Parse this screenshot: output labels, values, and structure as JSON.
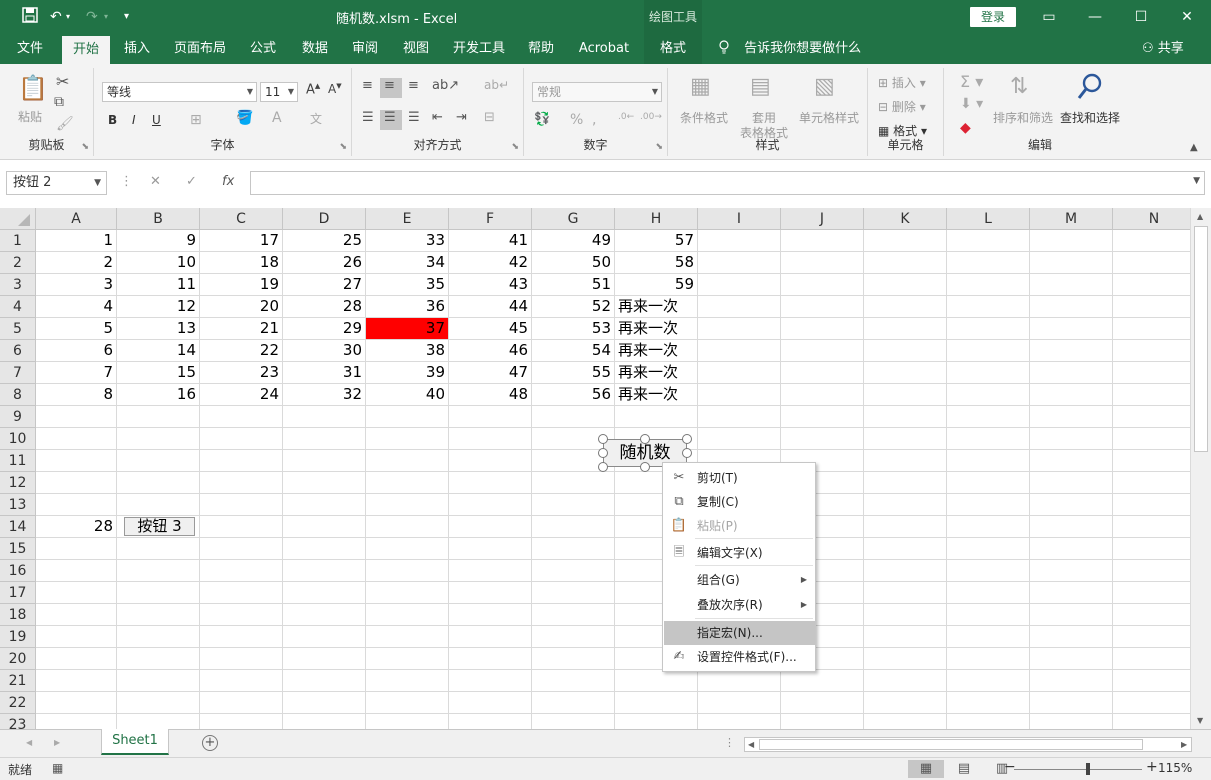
{
  "window": {
    "title": "随机数.xlsm  -  Excel",
    "drawing_tools": "绘图工具",
    "login": "登录",
    "tell_me": "告诉我你想要做什么",
    "share": "共享"
  },
  "tabs": [
    "文件",
    "开始",
    "插入",
    "页面布局",
    "公式",
    "数据",
    "审阅",
    "视图",
    "开发工具",
    "帮助",
    "Acrobat",
    "格式"
  ],
  "active_tab": "开始",
  "ribbon": {
    "clipboard": {
      "label": "剪贴板",
      "paste": "粘贴"
    },
    "font": {
      "label": "字体",
      "font_name": "等线",
      "font_size": "11",
      "bold": "B",
      "italic": "I",
      "underline": "U"
    },
    "align": {
      "label": "对齐方式"
    },
    "number": {
      "label": "数字",
      "format": "常规"
    },
    "styles": {
      "label": "样式",
      "conditional": "条件格式",
      "table_format_1": "套用",
      "table_format_2": "表格格式",
      "cell_styles": "单元格样式"
    },
    "cells": {
      "label": "单元格",
      "insert": "插入",
      "delete": "删除",
      "format": "格式"
    },
    "editing": {
      "label": "编辑",
      "sort_filter": "排序和筛选",
      "find_select_1": "查找和选择"
    }
  },
  "formula_bar": {
    "name_box": "按钮 2",
    "fx": "fx",
    "value": ""
  },
  "columns": [
    "A",
    "B",
    "C",
    "D",
    "E",
    "F",
    "G",
    "H",
    "I",
    "J",
    "K",
    "L",
    "M",
    "N"
  ],
  "rows": [
    "1",
    "2",
    "3",
    "4",
    "5",
    "6",
    "7",
    "8",
    "9",
    "10",
    "11",
    "12",
    "13",
    "14",
    "15",
    "16",
    "17",
    "18",
    "19",
    "20",
    "21",
    "22",
    "23"
  ],
  "cells": [
    [
      "1",
      "9",
      "17",
      "25",
      "33",
      "41",
      "49",
      "57"
    ],
    [
      "2",
      "10",
      "18",
      "26",
      "34",
      "42",
      "50",
      "58"
    ],
    [
      "3",
      "11",
      "19",
      "27",
      "35",
      "43",
      "51",
      "59"
    ],
    [
      "4",
      "12",
      "20",
      "28",
      "36",
      "44",
      "52",
      "再来一次"
    ],
    [
      "5",
      "13",
      "21",
      "29",
      "37",
      "45",
      "53",
      "再来一次"
    ],
    [
      "6",
      "14",
      "22",
      "30",
      "38",
      "46",
      "54",
      "再来一次"
    ],
    [
      "7",
      "15",
      "23",
      "31",
      "39",
      "47",
      "55",
      "再来一次"
    ],
    [
      "8",
      "16",
      "24",
      "32",
      "40",
      "48",
      "56",
      "再来一次"
    ]
  ],
  "highlight": {
    "cell": "E5",
    "color": "#ff0000"
  },
  "a14_value": "28",
  "buttons": {
    "random": "随机数",
    "button3": "按钮 3"
  },
  "context_menu": [
    {
      "label": "剪切(T)",
      "icon": "scissors-icon",
      "disabled": false
    },
    {
      "label": "复制(C)",
      "icon": "copy-icon",
      "disabled": false
    },
    {
      "label": "粘贴(P)",
      "icon": "paste-icon",
      "disabled": true
    },
    {
      "label": "编辑文字(X)",
      "icon": "edit-text-icon",
      "disabled": false
    },
    {
      "label": "组合(G)",
      "icon": "",
      "disabled": false,
      "submenu": true
    },
    {
      "label": "叠放次序(R)",
      "icon": "",
      "disabled": false,
      "submenu": true
    },
    {
      "label": "指定宏(N)...",
      "icon": "",
      "disabled": false,
      "hover": true
    },
    {
      "label": "设置控件格式(F)...",
      "icon": "format-control-icon",
      "disabled": false
    }
  ],
  "sheet": {
    "name": "Sheet1"
  },
  "status": {
    "ready": "就绪",
    "zoom": "115%"
  },
  "colors": {
    "excel_green": "#217346",
    "selection_gray": "#c6c6c6"
  }
}
